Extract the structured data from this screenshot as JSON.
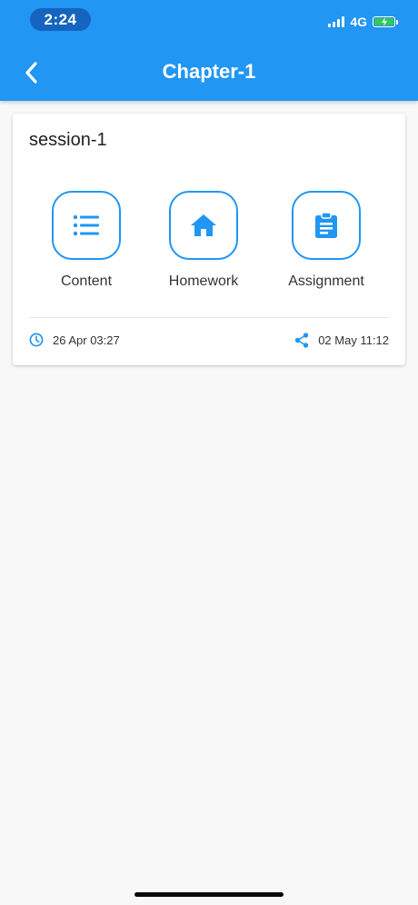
{
  "status_bar": {
    "time": "2:24",
    "network": "4G"
  },
  "header": {
    "title": "Chapter-1",
    "back_icon": "chevron-left-icon"
  },
  "session": {
    "title": "session-1",
    "actions": [
      {
        "label": "Content",
        "icon": "list-icon"
      },
      {
        "label": "Homework",
        "icon": "home-icon"
      },
      {
        "label": "Assignment",
        "icon": "clipboard-icon"
      }
    ],
    "created": {
      "icon": "clock-icon",
      "text": "26 Apr 03:27"
    },
    "shared": {
      "icon": "share-icon",
      "text": "02 May 11:12"
    }
  },
  "colors": {
    "primary": "#2196f3",
    "background": "#f8f8f8",
    "card": "#ffffff",
    "battery": "#34c759"
  }
}
